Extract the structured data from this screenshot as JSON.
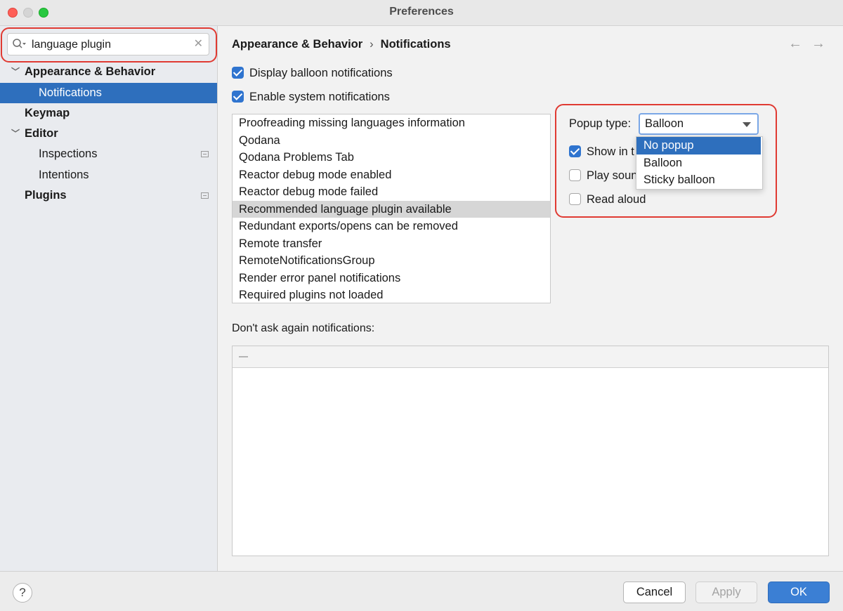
{
  "window": {
    "title": "Preferences"
  },
  "search": {
    "value": "language plugin"
  },
  "sidebar": {
    "items": [
      {
        "label": "Appearance & Behavior",
        "bold": true,
        "expanded": true
      },
      {
        "label": "Notifications",
        "selected": true
      },
      {
        "label": "Keymap",
        "bold": true
      },
      {
        "label": "Editor",
        "bold": true,
        "expanded": true
      },
      {
        "label": "Inspections"
      },
      {
        "label": "Intentions"
      },
      {
        "label": "Plugins",
        "bold": true
      }
    ]
  },
  "breadcrumb": {
    "parent": "Appearance & Behavior",
    "separator": "›",
    "current": "Notifications"
  },
  "nav": {
    "back": "←",
    "forward": "→"
  },
  "options": {
    "balloon": {
      "label": "Display balloon notifications",
      "checked": true
    },
    "system": {
      "label": "Enable system notifications",
      "checked": true
    }
  },
  "notification_groups": [
    "Proofreading missing languages information",
    "Qodana",
    "Qodana Problems Tab",
    "Reactor debug mode enabled",
    "Reactor debug mode failed",
    "Recommended language plugin available",
    "Redundant exports/opens can be removed",
    "Remote transfer",
    "RemoteNotificationsGroup",
    "Render error panel notifications",
    "Required plugins not loaded"
  ],
  "selected_group": "Recommended language plugin available",
  "group_settings": {
    "popup_type_label": "Popup type:",
    "popup_type_value": "Balloon",
    "popup_type_options": [
      "No popup",
      "Balloon",
      "Sticky balloon"
    ],
    "popup_highlighted_option": "No popup",
    "show_in_label": "Show in t",
    "show_in_checked": true,
    "play_sound_label": "Play soun",
    "play_sound_checked": false,
    "read_aloud_label": "Read aloud",
    "read_aloud_checked": false
  },
  "dont_ask": {
    "label": "Don't ask again notifications:"
  },
  "footer": {
    "help": "?",
    "cancel": "Cancel",
    "apply": "Apply",
    "ok": "OK"
  },
  "colors": {
    "accent": "#2e6fbd",
    "highlight_outline": "#e03a32",
    "ok_button": "#3b7fd4"
  }
}
